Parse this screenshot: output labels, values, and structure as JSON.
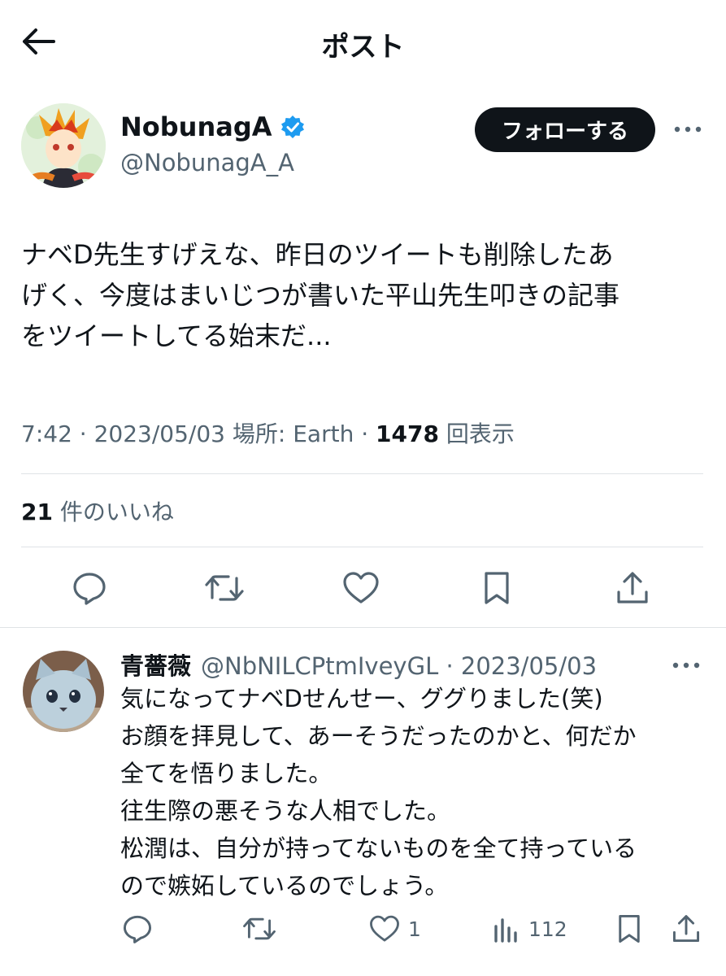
{
  "header": {
    "title": "ポスト"
  },
  "author": {
    "name": "NobunagA",
    "handle": "@NobunagA_A",
    "verified_color": "#1d9bf0",
    "follow_label": "フォローする"
  },
  "tweet": {
    "lines": [
      "ナベD先生すげえな、昨日のツイートも削除したあ",
      "げく、今度はまいじつが書いた平山先生叩きの記事",
      "をツイートしてる始末だ..."
    ],
    "time": "7:42",
    "date": "2023/05/03",
    "location_label": "場所: Earth",
    "views_count": "1478",
    "views_label": "回表示",
    "likes_count": "21",
    "likes_label": "件のいいね"
  },
  "actions": {
    "icons": [
      "reply-icon",
      "retweet-icon",
      "like-icon",
      "bookmark-icon",
      "share-icon"
    ]
  },
  "reply": {
    "name": "青薔薇",
    "handle_date": "@NbNILCPtmIveyGL · 2023/05/03",
    "lines": [
      "気になってナベDせんせー、ググりました(笑)",
      "お顔を拝見して、あーそうだったのかと、何だか",
      "全てを悟りました。",
      "往生際の悪そうな人相でした。",
      "松潤は、自分が持ってないものを全て持っている",
      "ので嫉妬しているのでしょう。"
    ],
    "like_count": "1",
    "view_count": "112"
  },
  "colors": {
    "text": "#0f1419",
    "secondary": "#536471",
    "divider": "#dfe3e6",
    "accent": "#1d9bf0"
  }
}
